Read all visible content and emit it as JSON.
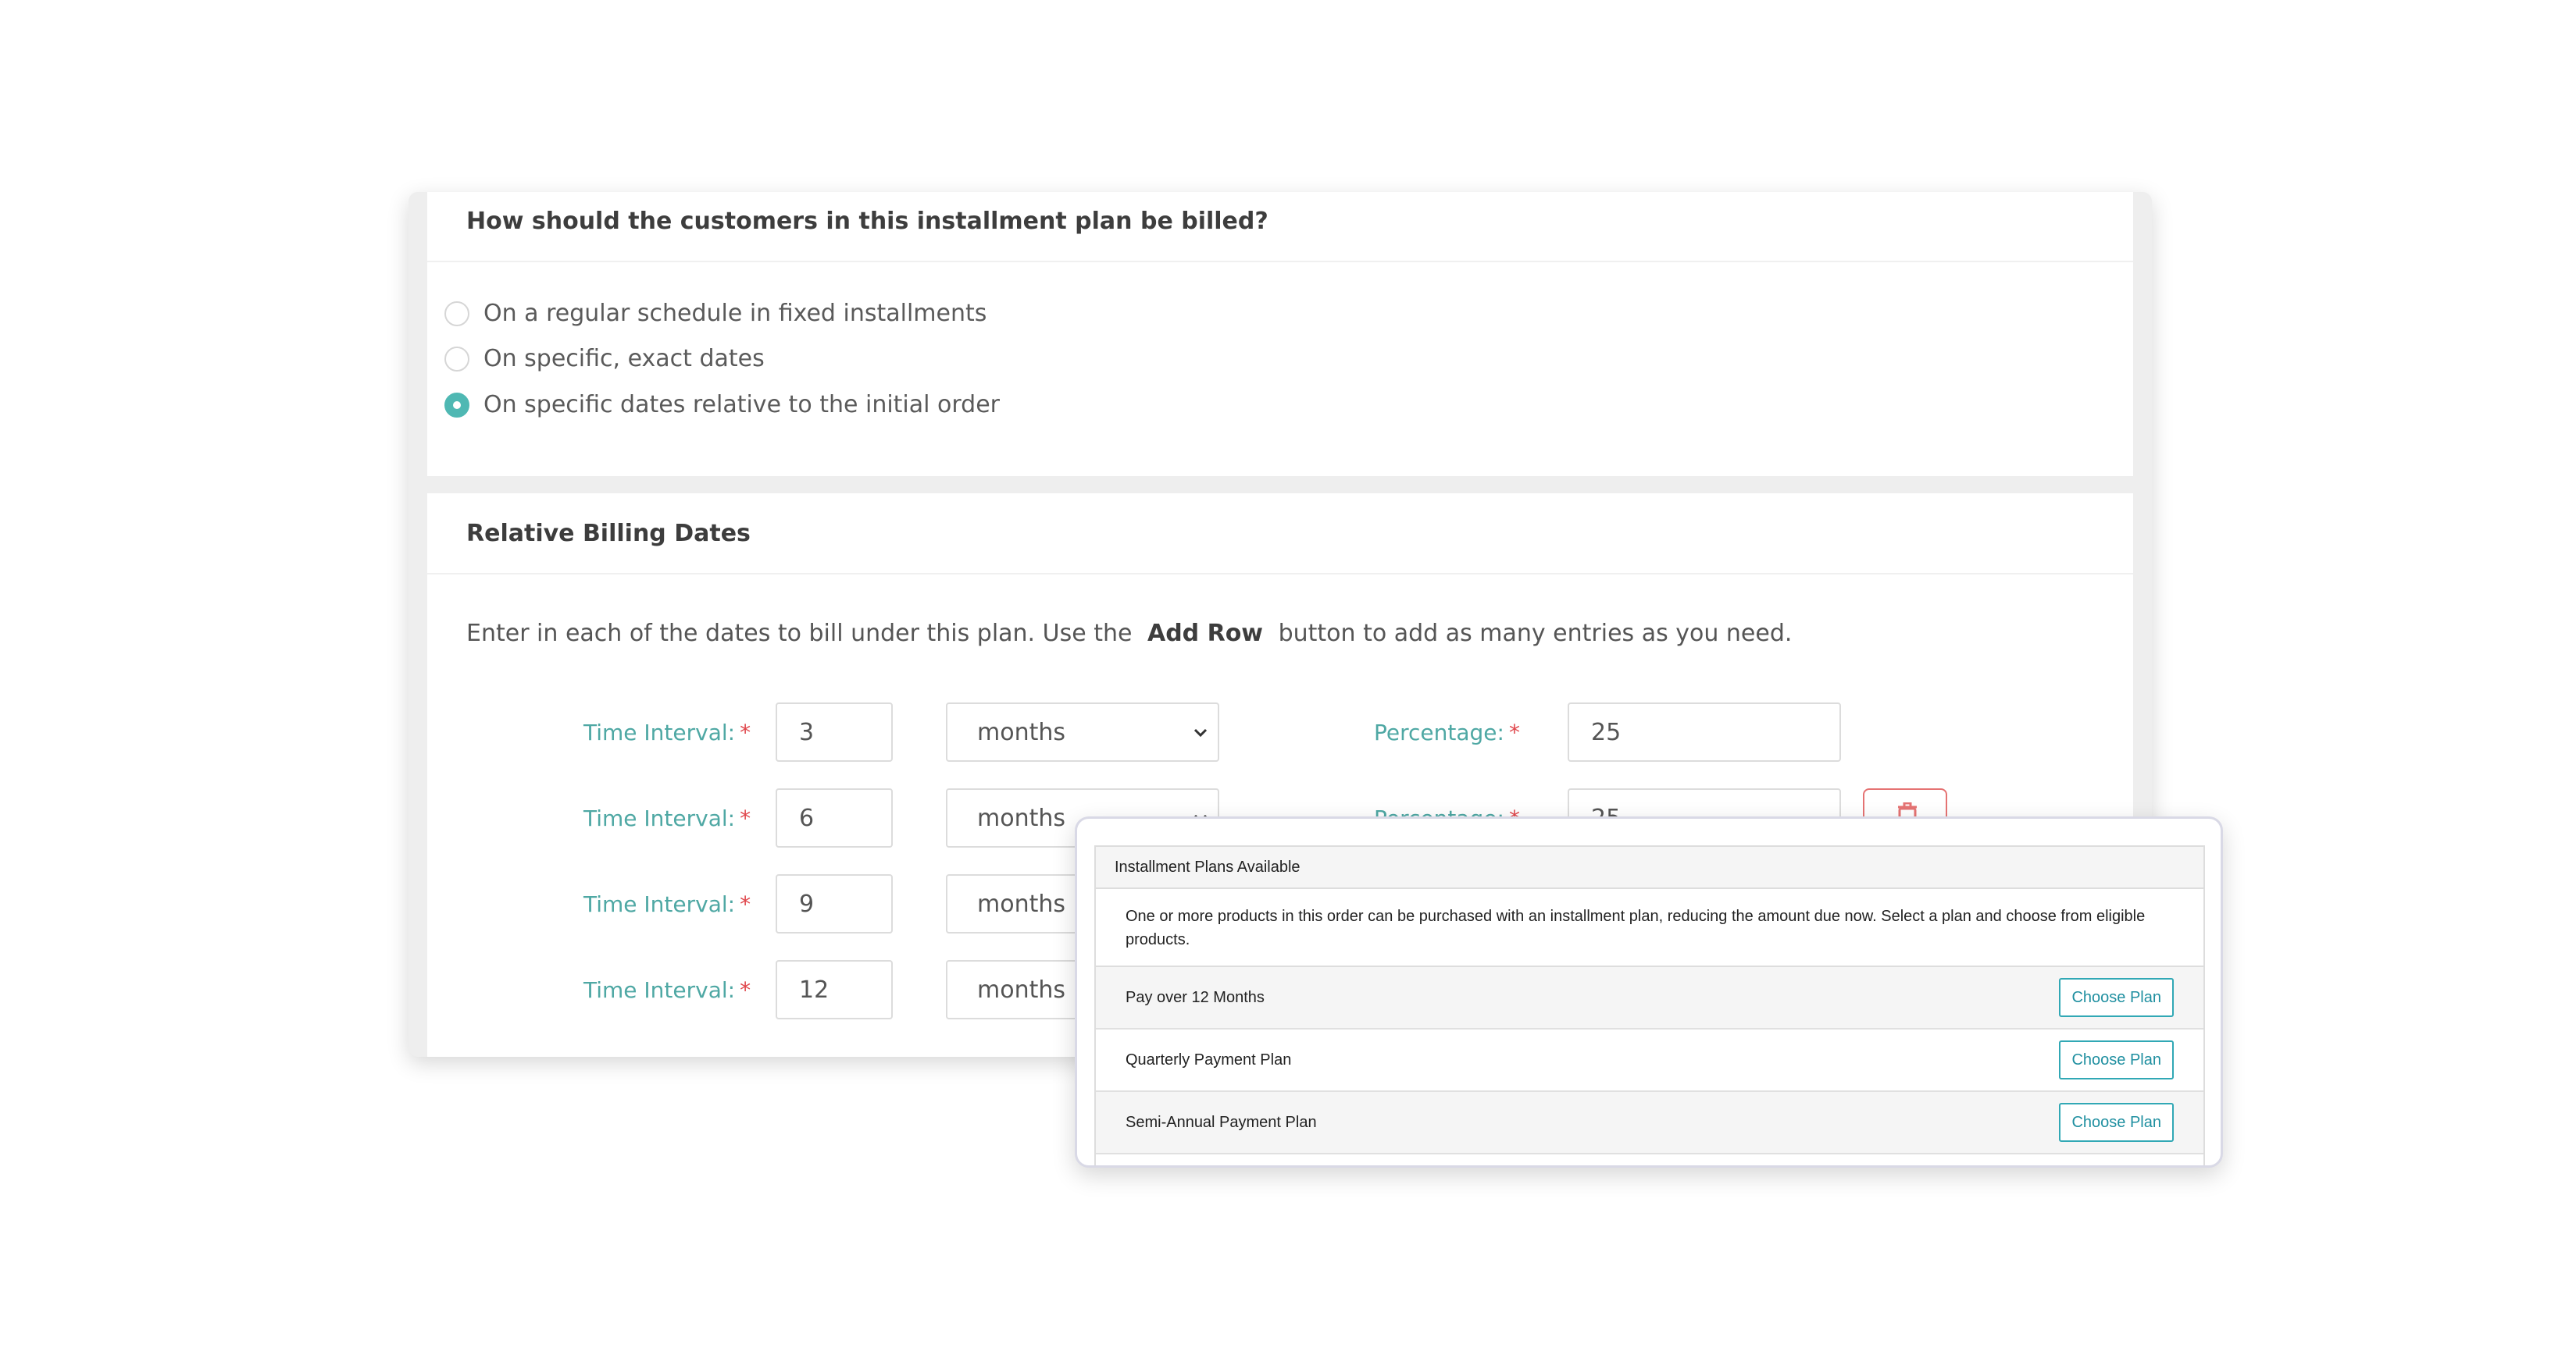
{
  "billing": {
    "question": "How should the customers in this installment plan be billed?",
    "options": [
      {
        "label": "On a regular schedule in fixed installments",
        "selected": false
      },
      {
        "label": "On specific, exact dates",
        "selected": false
      },
      {
        "label": "On specific dates relative to the initial order",
        "selected": true
      }
    ]
  },
  "relative": {
    "title": "Relative Billing Dates",
    "instruction_before": "Enter in each of the dates to bill under this plan. Use the",
    "instruction_bold": "Add Row",
    "instruction_after": "button to add as many entries as you need.",
    "interval_label": "Time Interval:",
    "percentage_label": "Percentage:",
    "required_mark": "*",
    "rows": [
      {
        "interval": "3",
        "unit": "months",
        "percentage": "25"
      },
      {
        "interval": "6",
        "unit": "months",
        "percentage": "25"
      },
      {
        "interval": "9",
        "unit": "months",
        "percentage": ""
      },
      {
        "interval": "12",
        "unit": "months",
        "percentage": ""
      }
    ]
  },
  "modal": {
    "heading": "Installment Plans Available",
    "description": "One or more products in this order can be purchased with an installment plan, reducing the amount due now. Select a plan and choose from eligible products.",
    "choose_label": "Choose Plan",
    "plans": [
      {
        "name": "Pay over 12 Months"
      },
      {
        "name": "Quarterly Payment Plan"
      },
      {
        "name": "Semi-Annual Payment Plan"
      }
    ]
  },
  "colors": {
    "accent": "#4fb8b3",
    "label": "#4fa8a4",
    "required": "#e0474c",
    "button_border": "#31a8b5"
  }
}
